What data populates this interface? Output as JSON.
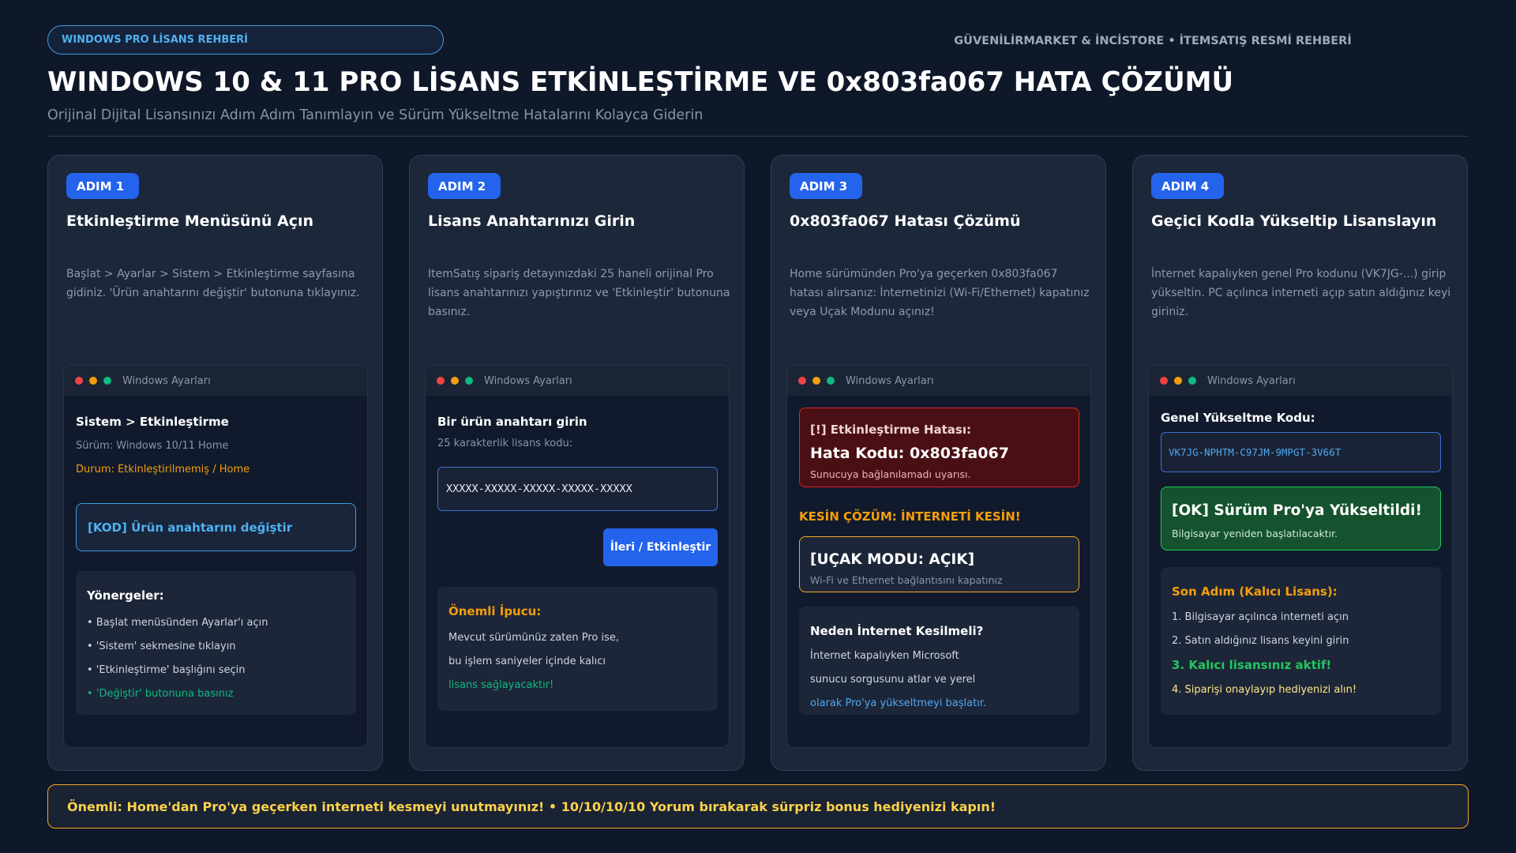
{
  "header": {
    "badge": "WINDOWS PRO LİSANS REHBERİ",
    "top_right": "GÜVENİLİRMARKET & İNCİSTORE • İTEMSATIŞ RESMİ REHBERİ",
    "title": "WINDOWS 10 & 11 PRO LİSANS ETKİNLEŞTİRME VE 0x803fa067 HATA ÇÖZÜMÜ",
    "subtitle": "Orijinal Dijital Lisansınızı Adım Adım Tanımlayın ve Sürüm Yükseltme Hatalarını Kolayca Giderin"
  },
  "window_title": "Windows Ayarları",
  "colors": {
    "background": "#0f1829",
    "card": "#1c2739",
    "accent_blue": "#2463eb",
    "orange": "#f59e0b",
    "green": "#10b981",
    "error_red": "#4a0f14"
  },
  "steps": [
    {
      "badge": "ADIM 1",
      "title": "Etkinleştirme Menüsünü Açın",
      "desc": "Başlat > Ayarlar > Sistem > Etkinleştirme sayfasına gidiniz. 'Ürün anahtarını değiştir' butonuna tıklayınız.",
      "section": "Sistem > Etkinleştirme",
      "version": "Sürüm: Windows 10/11 Home",
      "status": "Durum: Etkinleştirilmemiş / Home",
      "button": "[KOD] Ürün anahtarını değiştir",
      "guide_title": "Yönergeler:",
      "guide": [
        "• Başlat menüsünden Ayarlar'ı açın",
        "• 'Sistem' sekmesine tıklayın",
        "• 'Etkinleştirme' başlığını seçin",
        "• 'Değiştir' butonuna basınız"
      ]
    },
    {
      "badge": "ADIM 2",
      "title": "Lisans Anahtarınızı Girin",
      "desc": "ItemSatış sipariş detayınızdaki 25 haneli orijinal Pro lisans anahtarınızı yapıştırınız ve 'Etkinleştir' butonuna basınız.",
      "dialog_title": "Bir ürün anahtarı girin",
      "dialog_sub": "25 karakterlik lisans kodu:",
      "key_value": "XXXXX-XXXXX-XXXXX-XXXXX-XXXXX",
      "next_button": "İleri / Etkinleştir",
      "tip_title": "Önemli İpucu:",
      "tip_lines": [
        "Mevcut sürümünüz zaten Pro ise,",
        "bu işlem saniyeler içinde kalıcı",
        "lisans sağlayacaktır!"
      ]
    },
    {
      "badge": "ADIM 3",
      "title": "0x803fa067 Hatası Çözümü",
      "desc": "Home sürümünden Pro'ya geçerken 0x803fa067 hatası alırsanız: İnternetinizi (Wi-Fi/Ethernet) kapatınız veya Uçak Modunu açınız!",
      "error_title": "[!] Etkinleştirme Hatası:",
      "error_code": "Hata Kodu: 0x803fa067",
      "error_sub": "Sunucuya bağlanılamadı uyarısı.",
      "solution": "KESİN ÇÖZÜM: İNTERNETİ KESİN!",
      "airplane_title": "[UÇAK MODU: AÇIK]",
      "airplane_sub": "Wi-Fi ve Ethernet bağlantısını kapatınız",
      "why_title": "Neden İnternet Kesilmeli?",
      "why_lines": [
        "İnternet kapalıyken Microsoft",
        "sunucu sorgusunu atlar ve yerel",
        "olarak Pro'ya yükseltmeyi başlatır."
      ]
    },
    {
      "badge": "ADIM 4",
      "title": "Geçici Kodla Yükseltip Lisanslayın",
      "desc": "İnternet kapalıyken genel Pro kodunu (VK7JG-...) girip yükseltin. PC açılınca interneti açıp satın aldığınız keyi giriniz.",
      "code_label": "Genel Yükseltme Kodu:",
      "code_value": "VK7JG-NPHTM-C97JM-9MPGT-3V66T",
      "ok_title": "[OK] Sürüm Pro'ya Yükseltildi!",
      "ok_sub": "Bilgisayar yeniden başlatılacaktır.",
      "last_title": "Son Adım (Kalıcı Lisans):",
      "last_items": [
        "1. Bilgisayar açılınca interneti açın",
        "2. Satın aldığınız lisans keyini girin",
        "3. Kalıcı lisansınız aktif!",
        "4. Siparişi onaylayıp hediyenizi alın!"
      ]
    }
  ],
  "footer": "Önemli: Home'dan Pro'ya geçerken interneti kesmeyi unutmayınız! • 10/10/10/10 Yorum bırakarak sürpriz bonus hediyenizi kapın!"
}
